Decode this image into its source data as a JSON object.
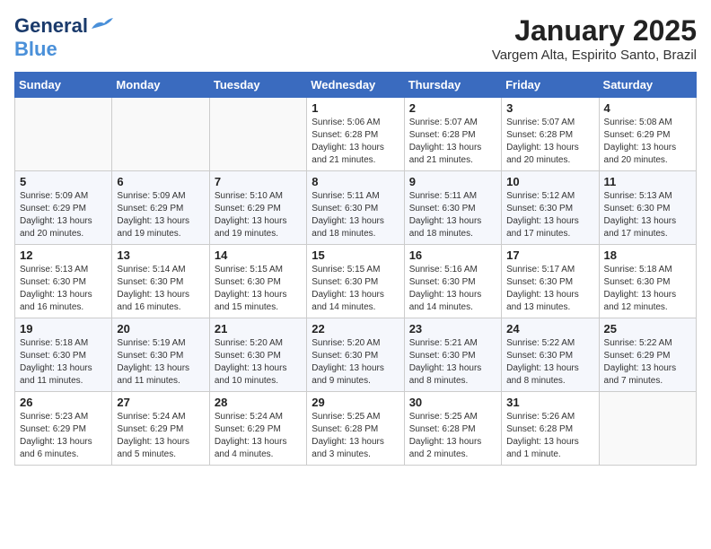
{
  "header": {
    "logo_general": "General",
    "logo_blue": "Blue",
    "title": "January 2025",
    "subtitle": "Vargem Alta, Espirito Santo, Brazil"
  },
  "days_of_week": [
    "Sunday",
    "Monday",
    "Tuesday",
    "Wednesday",
    "Thursday",
    "Friday",
    "Saturday"
  ],
  "weeks": [
    [
      {
        "day": "",
        "info": ""
      },
      {
        "day": "",
        "info": ""
      },
      {
        "day": "",
        "info": ""
      },
      {
        "day": "1",
        "info": "Sunrise: 5:06 AM\nSunset: 6:28 PM\nDaylight: 13 hours\nand 21 minutes."
      },
      {
        "day": "2",
        "info": "Sunrise: 5:07 AM\nSunset: 6:28 PM\nDaylight: 13 hours\nand 21 minutes."
      },
      {
        "day": "3",
        "info": "Sunrise: 5:07 AM\nSunset: 6:28 PM\nDaylight: 13 hours\nand 20 minutes."
      },
      {
        "day": "4",
        "info": "Sunrise: 5:08 AM\nSunset: 6:29 PM\nDaylight: 13 hours\nand 20 minutes."
      }
    ],
    [
      {
        "day": "5",
        "info": "Sunrise: 5:09 AM\nSunset: 6:29 PM\nDaylight: 13 hours\nand 20 minutes."
      },
      {
        "day": "6",
        "info": "Sunrise: 5:09 AM\nSunset: 6:29 PM\nDaylight: 13 hours\nand 19 minutes."
      },
      {
        "day": "7",
        "info": "Sunrise: 5:10 AM\nSunset: 6:29 PM\nDaylight: 13 hours\nand 19 minutes."
      },
      {
        "day": "8",
        "info": "Sunrise: 5:11 AM\nSunset: 6:30 PM\nDaylight: 13 hours\nand 18 minutes."
      },
      {
        "day": "9",
        "info": "Sunrise: 5:11 AM\nSunset: 6:30 PM\nDaylight: 13 hours\nand 18 minutes."
      },
      {
        "day": "10",
        "info": "Sunrise: 5:12 AM\nSunset: 6:30 PM\nDaylight: 13 hours\nand 17 minutes."
      },
      {
        "day": "11",
        "info": "Sunrise: 5:13 AM\nSunset: 6:30 PM\nDaylight: 13 hours\nand 17 minutes."
      }
    ],
    [
      {
        "day": "12",
        "info": "Sunrise: 5:13 AM\nSunset: 6:30 PM\nDaylight: 13 hours\nand 16 minutes."
      },
      {
        "day": "13",
        "info": "Sunrise: 5:14 AM\nSunset: 6:30 PM\nDaylight: 13 hours\nand 16 minutes."
      },
      {
        "day": "14",
        "info": "Sunrise: 5:15 AM\nSunset: 6:30 PM\nDaylight: 13 hours\nand 15 minutes."
      },
      {
        "day": "15",
        "info": "Sunrise: 5:15 AM\nSunset: 6:30 PM\nDaylight: 13 hours\nand 14 minutes."
      },
      {
        "day": "16",
        "info": "Sunrise: 5:16 AM\nSunset: 6:30 PM\nDaylight: 13 hours\nand 14 minutes."
      },
      {
        "day": "17",
        "info": "Sunrise: 5:17 AM\nSunset: 6:30 PM\nDaylight: 13 hours\nand 13 minutes."
      },
      {
        "day": "18",
        "info": "Sunrise: 5:18 AM\nSunset: 6:30 PM\nDaylight: 13 hours\nand 12 minutes."
      }
    ],
    [
      {
        "day": "19",
        "info": "Sunrise: 5:18 AM\nSunset: 6:30 PM\nDaylight: 13 hours\nand 11 minutes."
      },
      {
        "day": "20",
        "info": "Sunrise: 5:19 AM\nSunset: 6:30 PM\nDaylight: 13 hours\nand 11 minutes."
      },
      {
        "day": "21",
        "info": "Sunrise: 5:20 AM\nSunset: 6:30 PM\nDaylight: 13 hours\nand 10 minutes."
      },
      {
        "day": "22",
        "info": "Sunrise: 5:20 AM\nSunset: 6:30 PM\nDaylight: 13 hours\nand 9 minutes."
      },
      {
        "day": "23",
        "info": "Sunrise: 5:21 AM\nSunset: 6:30 PM\nDaylight: 13 hours\nand 8 minutes."
      },
      {
        "day": "24",
        "info": "Sunrise: 5:22 AM\nSunset: 6:30 PM\nDaylight: 13 hours\nand 8 minutes."
      },
      {
        "day": "25",
        "info": "Sunrise: 5:22 AM\nSunset: 6:29 PM\nDaylight: 13 hours\nand 7 minutes."
      }
    ],
    [
      {
        "day": "26",
        "info": "Sunrise: 5:23 AM\nSunset: 6:29 PM\nDaylight: 13 hours\nand 6 minutes."
      },
      {
        "day": "27",
        "info": "Sunrise: 5:24 AM\nSunset: 6:29 PM\nDaylight: 13 hours\nand 5 minutes."
      },
      {
        "day": "28",
        "info": "Sunrise: 5:24 AM\nSunset: 6:29 PM\nDaylight: 13 hours\nand 4 minutes."
      },
      {
        "day": "29",
        "info": "Sunrise: 5:25 AM\nSunset: 6:28 PM\nDaylight: 13 hours\nand 3 minutes."
      },
      {
        "day": "30",
        "info": "Sunrise: 5:25 AM\nSunset: 6:28 PM\nDaylight: 13 hours\nand 2 minutes."
      },
      {
        "day": "31",
        "info": "Sunrise: 5:26 AM\nSunset: 6:28 PM\nDaylight: 13 hours\nand 1 minute."
      },
      {
        "day": "",
        "info": ""
      }
    ]
  ]
}
